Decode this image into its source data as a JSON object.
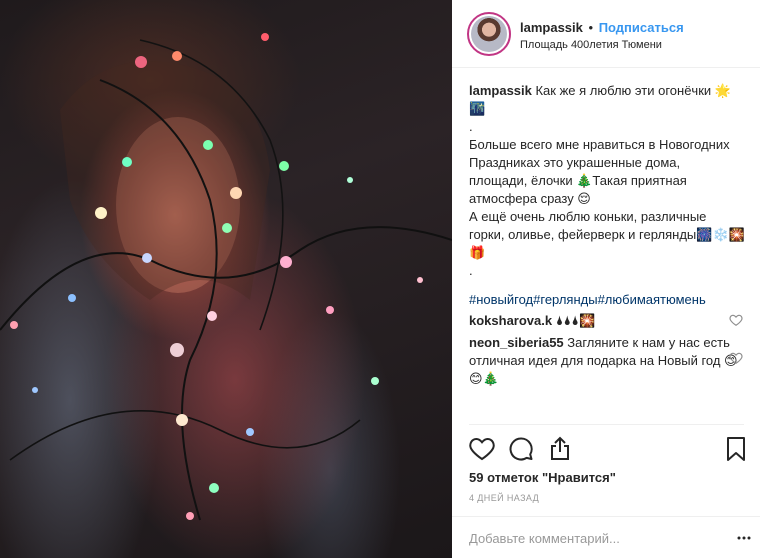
{
  "post": {
    "username": "lampassik",
    "separator": "•",
    "follow_label": "Подписаться",
    "location": "Площадь 400летия Тюмени"
  },
  "caption": {
    "username": "lampassik",
    "lines": [
      " Как же я люблю эти огонёчки 🌟",
      "🌃",
      ".",
      "Больше всего мне нравиться в Новогодних",
      "Праздниках это украшенные дома,",
      "площади, ёлочки 🎄Такая приятная",
      "атмосфера сразу 😌",
      "А ещё очень люблю коньки, различные",
      "горки, оливье, фейерверк и герлянды🎆❄️🎇",
      "🎁",
      "."
    ],
    "hashtags": "#новыйгод#герлянды#любимаятюмень"
  },
  "comments": [
    {
      "username": "koksharova.k",
      "text": " 🌢🌢🌢🎇"
    },
    {
      "username": "neon_siberia55",
      "text": " Загляните к нам у нас есть отличная идея для подарка на Новый год 😊😊🎄"
    }
  ],
  "icons": {
    "like": "heart-outline-icon",
    "comment": "speech-bubble-icon",
    "share": "share-icon",
    "save": "bookmark-icon",
    "comment_like": "small-heart-icon",
    "more": "ellipsis-icon"
  },
  "stats": {
    "likes": "59 отметок \"Нравится\"",
    "time": "4 дней назад"
  },
  "add_comment": {
    "placeholder": "Добавьте комментарий..."
  },
  "colors": {
    "link": "#3897f0",
    "hashtag": "#003569",
    "text": "#262626",
    "muted": "#999999",
    "border": "#efefef"
  }
}
